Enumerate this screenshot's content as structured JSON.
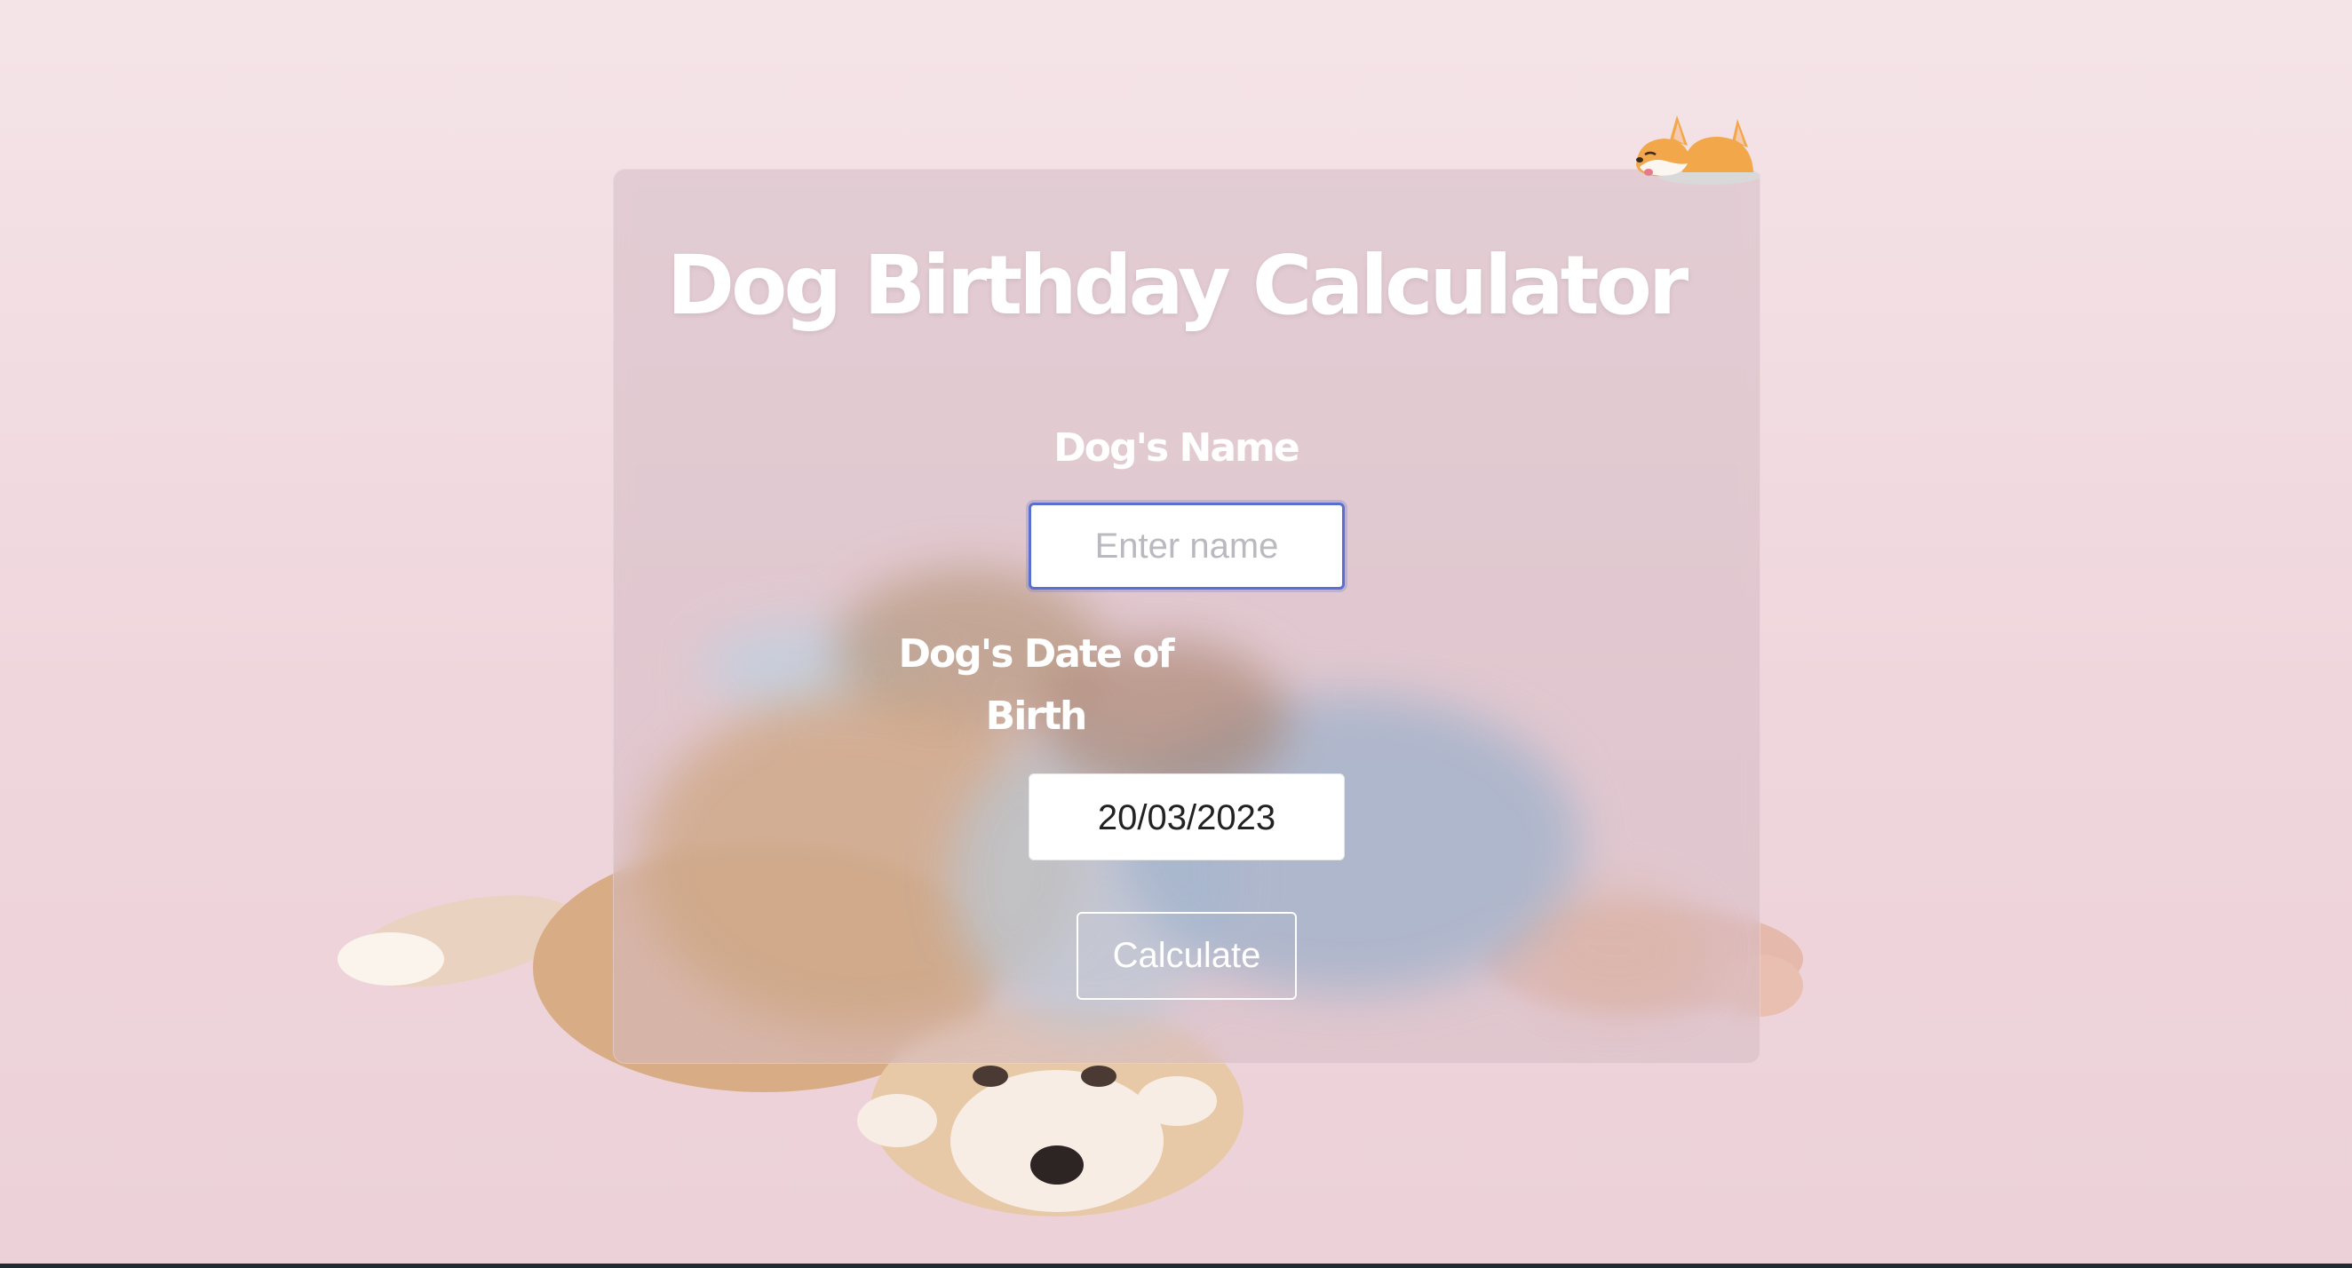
{
  "app": {
    "title": "Dog Birthday Calculator"
  },
  "form": {
    "name_label": "Dog's Name",
    "name_placeholder": "Enter name",
    "name_value": "",
    "dob_label": "Dog's Date of Birth",
    "dob_value": "20/03/2023",
    "calculate_label": "Calculate"
  },
  "icons": {
    "logo": "sleeping-corgi-icon"
  },
  "colors": {
    "background": "#f1dde2",
    "card": "#d8c0c7",
    "focus_ring": "#5b6fd0",
    "text": "#ffffff"
  }
}
